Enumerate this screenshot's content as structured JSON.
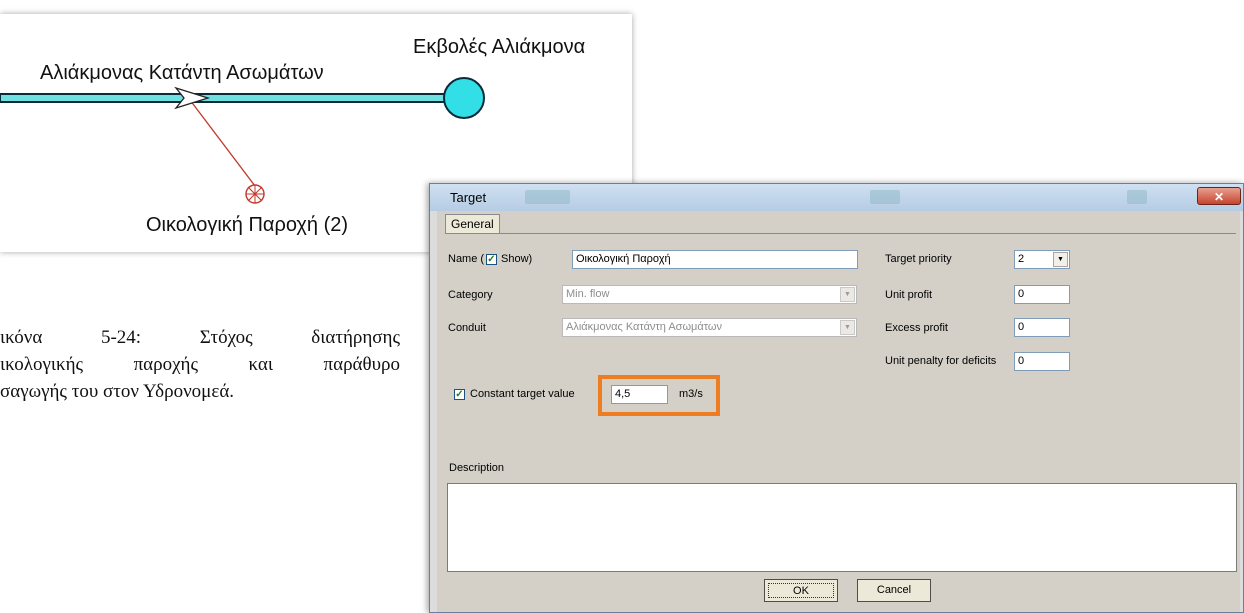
{
  "diagram": {
    "label_river": "Αλιάκμονας Κατάντη Ασωμάτων",
    "label_outlet": "Εκβολές Αλιάκμονα",
    "label_target": "Οικολογική Παροχή (2)",
    "colors": {
      "conduit": "#6fe0e0",
      "node": "#33dfe6",
      "target_link": "#c0392b"
    }
  },
  "caption": {
    "line1_left": "ικόνα",
    "line1_mid": "5-24:",
    "line1_w1": "Στόχος",
    "line1_w2": "διατήρησης",
    "line2_a": "ικολογικής",
    "line2_b": "παροχής",
    "line2_c": "και",
    "line2_d": "παράθυρο",
    "line3": "σαγωγής του στον Υδρονομεά."
  },
  "dialog": {
    "title": "Target",
    "close_icon": "✕",
    "tab_general": "General",
    "name_label_pre": "Name (",
    "name_label_post": "Show)",
    "name_value": "Οικολογική Παροχή",
    "category_label": "Category",
    "category_value": "Min. flow",
    "conduit_label": "Conduit",
    "conduit_value": "Αλιάκμονας Κατάντη Ασωμάτων",
    "target_priority_label": "Target priority",
    "target_priority_value": "2",
    "unit_profit_label": "Unit profit",
    "unit_profit_value": "0",
    "excess_profit_label": "Excess profit",
    "excess_profit_value": "0",
    "unit_penalty_label": "Unit penalty for deficits",
    "unit_penalty_value": "0",
    "constant_target_label": "Constant target value",
    "constant_target_value": "4,5",
    "constant_target_unit": "m3/s",
    "description_label": "Description",
    "ok_label": "OK",
    "cancel_label": "Cancel",
    "colors": {
      "highlight": "#ee7d22"
    }
  }
}
